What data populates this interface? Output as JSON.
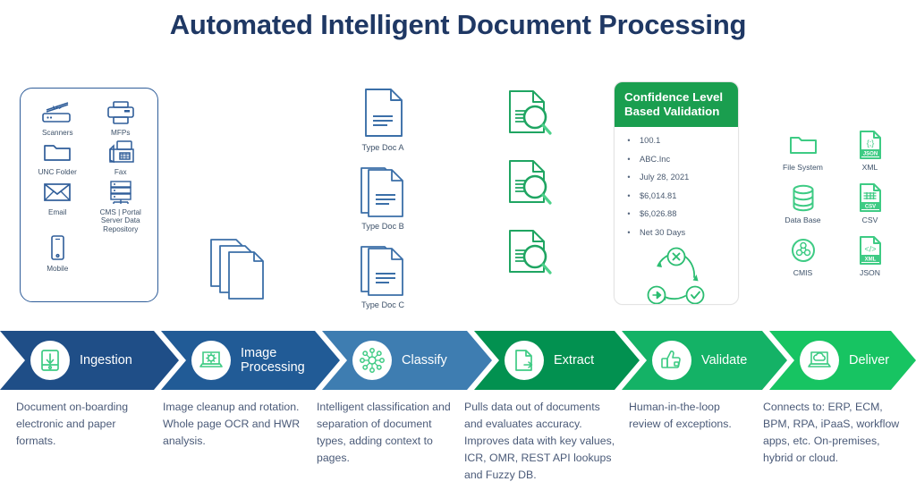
{
  "title": "Automated Intelligent Document Processing",
  "colors": {
    "title_navy": "#1f3864",
    "source_blue": "#2f5d99",
    "green": "#2bae66",
    "stage_ingestion": "#1f4e87",
    "stage_image_processing": "#215b96",
    "stage_classify": "#3e7db1",
    "stage_extract": "#029150",
    "stage_validate": "#14b266",
    "stage_deliver": "#17c462",
    "body_text": "#4a5a78"
  },
  "sources": {
    "items": [
      {
        "label": "Scanners",
        "icon": "scanner-icon"
      },
      {
        "label": "MFPs",
        "icon": "printer-icon"
      },
      {
        "label": "UNC Folder",
        "icon": "folder-icon"
      },
      {
        "label": "Fax",
        "icon": "fax-icon"
      },
      {
        "label": "Email",
        "icon": "envelope-icon"
      },
      {
        "label": "CMS | Portal Server Data Repository",
        "icon": "server-icon"
      },
      {
        "label": "Mobile",
        "icon": "mobile-icon"
      }
    ]
  },
  "doc_types": [
    {
      "label": "Type Doc A",
      "icon": "document-single-icon"
    },
    {
      "label": "Type Doc B",
      "icon": "document-stack-icon"
    },
    {
      "label": "Type Doc C",
      "icon": "document-stack-icon"
    }
  ],
  "page_stack": {
    "icon": "page-stack-icon",
    "count": 3
  },
  "extract_items": [
    {
      "icon": "document-magnifier-icon"
    },
    {
      "icon": "document-magnifier-icon"
    },
    {
      "icon": "document-magnifier-icon"
    }
  ],
  "validation_card": {
    "header": "Confidence Level Based Validation",
    "fields": [
      "100.1",
      "ABC.Inc",
      "July 28, 2021",
      "$6,014.81",
      "$6,026.88",
      "Net 30 Days"
    ],
    "cycle_icons": [
      "reject-x-icon",
      "approve-check-icon",
      "route-arrow-icon"
    ]
  },
  "outputs": {
    "items": [
      {
        "label": "File System",
        "icon": "folder-icon"
      },
      {
        "label": "XML",
        "icon": "json-file-icon",
        "badge": "JSON",
        "glyph": "{;}"
      },
      {
        "label": "Data Base",
        "icon": "database-icon"
      },
      {
        "label": "CSV",
        "icon": "csv-file-icon",
        "badge": "CSV",
        "glyph": "grid"
      },
      {
        "label": "CMIS",
        "icon": "cmis-icon"
      },
      {
        "label": "JSON",
        "icon": "xml-file-icon",
        "badge": "XML",
        "glyph": "</>"
      }
    ]
  },
  "stages": [
    {
      "label": "Ingestion",
      "icon": "scanner-down-arrow-icon",
      "color": "#1f4e87",
      "description": "Document on-boarding electronic and paper formats."
    },
    {
      "label": "Image Processing",
      "icon": "laptop-gear-icon",
      "color": "#215b96",
      "description": "Image cleanup and rotation. Whole page OCR and HWR analysis."
    },
    {
      "label": "Classify",
      "icon": "network-nodes-icon",
      "color": "#3e7db1",
      "description": "Intelligent classification and separation of document types, adding context to pages."
    },
    {
      "label": "Extract",
      "icon": "document-export-icon",
      "color": "#029150",
      "description": "Pulls data out of documents and evaluates accuracy. Improves data with key values, ICR, OMR, REST API lookups and Fuzzy DB."
    },
    {
      "label": "Validate",
      "icon": "thumbs-up-icon",
      "color": "#14b266",
      "description": "Human-in-the-loop review of exceptions."
    },
    {
      "label": "Deliver",
      "icon": "laptop-cloud-icon",
      "color": "#17c462",
      "description": "Connects to: ERP, ECM, BPM, RPA, iPaaS, workflow apps, etc. On-premises, hybrid or cloud."
    }
  ]
}
